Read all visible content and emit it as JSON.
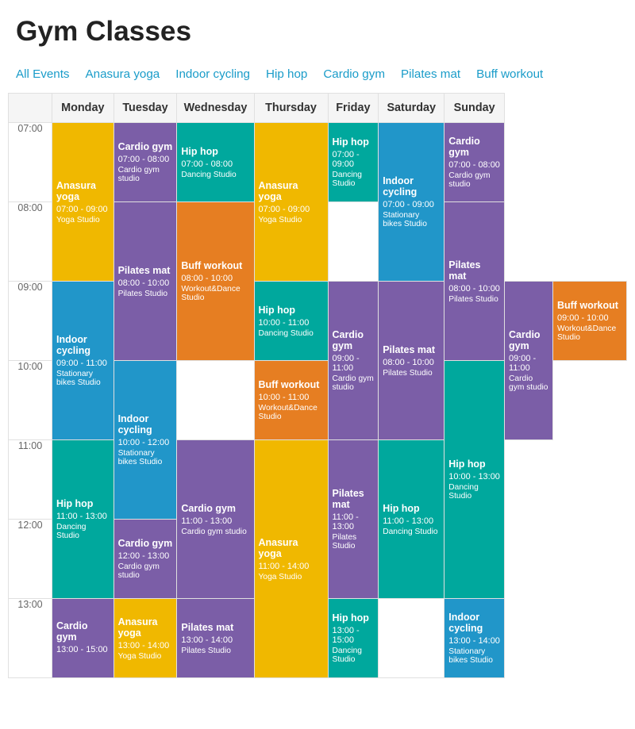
{
  "title": "Gym Classes",
  "filters": [
    {
      "label": "All Events",
      "active": false
    },
    {
      "label": "Anasura yoga",
      "active": false
    },
    {
      "label": "Indoor cycling",
      "active": false
    },
    {
      "label": "Hip hop",
      "active": false
    },
    {
      "label": "Cardio gym",
      "active": false
    },
    {
      "label": "Pilates mat",
      "active": false
    },
    {
      "label": "Buff workout",
      "active": false
    }
  ],
  "days": [
    "Monday",
    "Tuesday",
    "Wednesday",
    "Thursday",
    "Friday",
    "Saturday",
    "Sunday"
  ],
  "times": [
    "07:00",
    "08:00",
    "09:00",
    "10:00",
    "11:00",
    "12:00",
    "13:00"
  ],
  "schedule": {
    "07:00": {
      "Monday": {
        "name": "Anasura yoga",
        "time": "07:00 - 09:00",
        "location": "Yoga Studio",
        "color": "bg-yellow",
        "rowspan": 2
      },
      "Tuesday": {
        "name": "Cardio gym",
        "time": "07:00 - 08:00",
        "location": "Cardio gym studio",
        "color": "bg-purple"
      },
      "Wednesday": {
        "name": "Hip hop",
        "time": "07:00 - 08:00",
        "location": "Dancing Studio",
        "color": "bg-teal"
      },
      "Thursday": {
        "name": "Anasura yoga",
        "time": "07:00 - 09:00",
        "location": "Yoga Studio",
        "color": "bg-yellow",
        "rowspan": 2
      },
      "Friday": {
        "name": "Hip hop",
        "time": "07:00 - 09:00",
        "location": "Dancing Studio",
        "color": "bg-teal"
      },
      "Saturday": {
        "name": "Indoor cycling",
        "time": "07:00 - 09:00",
        "location": "Stationary bikes Studio",
        "color": "bg-blue",
        "rowspan": 2
      },
      "Sunday": {
        "name": "Cardio gym",
        "time": "07:00 - 08:00",
        "location": "Cardio gym studio",
        "color": "bg-purple"
      }
    },
    "08:00": {
      "Monday": null,
      "Tuesday": {
        "name": "Pilates mat",
        "time": "08:00 - 10:00",
        "location": "Pilates Studio",
        "color": "bg-purple",
        "rowspan": 2
      },
      "Wednesday": {
        "name": "Buff workout",
        "time": "08:00 - 10:00",
        "location": "Workout&Dance Studio",
        "color": "bg-orange",
        "rowspan": 2
      },
      "Thursday": null,
      "Friday": {
        "name": "Pilates mat",
        "time": "08:00 - 10:00",
        "location": "Pilates Studio",
        "color": "bg-purple",
        "rowspan": 2
      },
      "Saturday": null,
      "Sunday": {
        "name": "Pilates mat",
        "time": "08:00 - 10:00",
        "location": "Pilates Studio",
        "color": "bg-purple",
        "rowspan": 2
      }
    },
    "09:00": {
      "Monday": {
        "name": "Indoor cycling",
        "time": "09:00 - 11:00",
        "location": "Stationary bikes Studio",
        "color": "bg-blue",
        "rowspan": 2
      },
      "Tuesday": null,
      "Wednesday": {
        "name": "Hip hop",
        "time": "10:00 - 11:00",
        "location": "Dancing Studio",
        "color": "bg-teal"
      },
      "Thursday": {
        "name": "Cardio gym",
        "time": "09:00 - 11:00",
        "location": "Cardio gym studio",
        "color": "bg-purple",
        "rowspan": 2
      },
      "Friday": null,
      "Saturday": {
        "name": "Cardio gym",
        "time": "09:00 - 11:00",
        "location": "Cardio gym studio",
        "color": "bg-purple",
        "rowspan": 2
      },
      "Sunday": {
        "name": "Buff workout",
        "time": "09:00 - 10:00",
        "location": "Workout&Dance Studio",
        "color": "bg-orange"
      }
    },
    "10:00": {
      "Monday": null,
      "Tuesday": {
        "name": "Indoor cycling",
        "time": "10:00 - 12:00",
        "location": "Stationary bikes Studio",
        "color": "bg-blue",
        "rowspan": 2
      },
      "Wednesday": null,
      "Thursday": null,
      "Friday": {
        "name": "Buff workout",
        "time": "10:00 - 11:00",
        "location": "Workout&Dance Studio",
        "color": "bg-orange"
      },
      "Saturday": null,
      "Sunday": {
        "name": "Hip hop",
        "time": "10:00 - 13:00",
        "location": "Dancing Studio",
        "color": "bg-teal",
        "rowspan": 3
      }
    },
    "11:00": {
      "Monday": {
        "name": "Hip hop",
        "time": "11:00 - 13:00",
        "location": "Dancing Studio",
        "color": "bg-teal",
        "rowspan": 2
      },
      "Tuesday": null,
      "Wednesday": {
        "name": "Cardio gym",
        "time": "11:00 - 13:00",
        "location": "Cardio gym studio",
        "color": "bg-purple",
        "rowspan": 2
      },
      "Thursday": {
        "name": "Anasura yoga",
        "time": "11:00 - 14:00",
        "location": "Yoga Studio",
        "color": "bg-yellow",
        "rowspan": 3
      },
      "Friday": {
        "name": "Pilates mat",
        "time": "11:00 - 13:00",
        "location": "Pilates Studio",
        "color": "bg-purple",
        "rowspan": 2
      },
      "Saturday": {
        "name": "Hip hop",
        "time": "11:00 - 13:00",
        "location": "Dancing Studio",
        "color": "bg-teal",
        "rowspan": 2
      },
      "Sunday": null
    },
    "12:00": {
      "Monday": null,
      "Tuesday": {
        "name": "Cardio gym",
        "time": "12:00 - 13:00",
        "location": "Cardio gym studio",
        "color": "bg-purple"
      },
      "Wednesday": null,
      "Thursday": null,
      "Friday": null,
      "Saturday": null,
      "Sunday": {
        "name": "",
        "time": "",
        "location": "",
        "color": ""
      }
    },
    "13:00": {
      "Monday": {
        "name": "Cardio gym",
        "time": "13:00 - 15:00",
        "location": "",
        "color": "bg-purple"
      },
      "Tuesday": {
        "name": "Anasura yoga",
        "time": "13:00 - 14:00",
        "location": "Yoga Studio",
        "color": "bg-yellow"
      },
      "Wednesday": {
        "name": "Pilates mat",
        "time": "13:00 - 14:00",
        "location": "Pilates Studio",
        "color": "bg-purple"
      },
      "Thursday": null,
      "Friday": {
        "name": "Hip hop",
        "time": "13:00 - 15:00",
        "location": "Dancing Studio",
        "color": "bg-teal"
      },
      "Saturday": {
        "name": "",
        "time": "",
        "location": "",
        "color": ""
      },
      "Sunday": {
        "name": "Indoor cycling",
        "time": "13:00 - 14:00",
        "location": "Stationary bikes Studio",
        "color": "bg-blue"
      }
    }
  }
}
